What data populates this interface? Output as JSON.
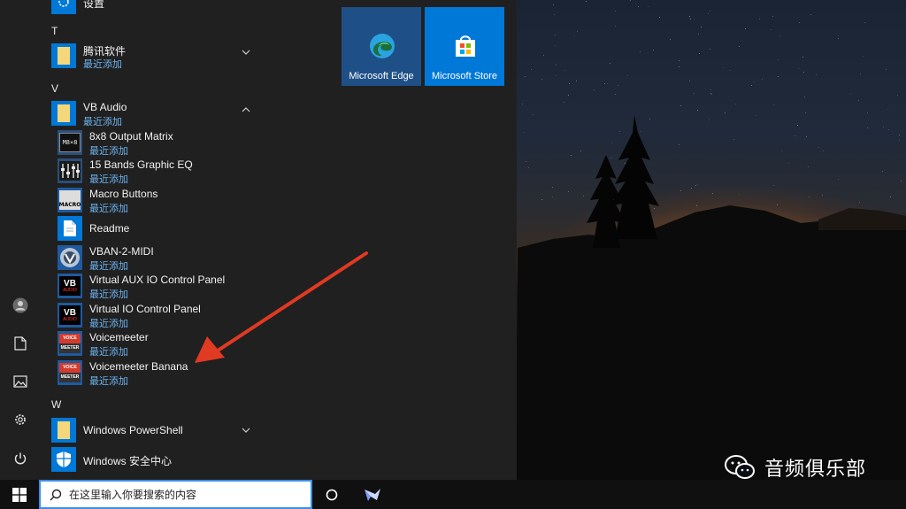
{
  "start_menu": {
    "partial_top_item": {
      "label": "设置"
    },
    "groups": [
      {
        "letter": "T",
        "items": [
          {
            "label": "腾讯软件",
            "sub": "最近添加",
            "icon": "folder-icon",
            "expandable": true
          }
        ]
      },
      {
        "letter": "V",
        "items": [
          {
            "label": "VB Audio",
            "sub": "最近添加",
            "icon": "folder-icon",
            "expanded": true
          }
        ]
      }
    ],
    "vb_audio_children": [
      {
        "label": "8x8 Output Matrix",
        "sub": "最近添加",
        "icon": "matrix-app-icon"
      },
      {
        "label": "15 Bands Graphic EQ",
        "sub": "最近添加",
        "icon": "equalizer-app-icon"
      },
      {
        "label": "Macro Buttons",
        "sub": "最近添加",
        "icon": "macro-app-icon"
      },
      {
        "label": "Readme",
        "sub": "",
        "icon": "document-icon"
      },
      {
        "label": "VBAN-2-MIDI",
        "sub": "最近添加",
        "icon": "vban-app-icon"
      },
      {
        "label": "Virtual AUX IO Control Panel",
        "sub": "最近添加",
        "icon": "vb-audio-icon"
      },
      {
        "label": "Virtual IO Control Panel",
        "sub": "最近添加",
        "icon": "vb-audio-icon"
      },
      {
        "label": "Voicemeeter",
        "sub": "最近添加",
        "icon": "voicemeeter-icon"
      },
      {
        "label": "Voicemeeter Banana",
        "sub": "最近添加",
        "icon": "voicemeeter-icon"
      }
    ],
    "group_w": {
      "letter": "W",
      "items": [
        {
          "label": "Windows PowerShell",
          "sub": "",
          "icon": "folder-icon",
          "expandable": true
        },
        {
          "label": "Windows 安全中心",
          "sub": "",
          "icon": "shield-icon"
        }
      ]
    },
    "tiles": [
      {
        "label": "Microsoft Edge",
        "icon": "edge-icon",
        "color": "#1f4f87"
      },
      {
        "label": "Microsoft Store",
        "icon": "store-icon",
        "color": "#0078d7"
      }
    ],
    "rail": {
      "icons": [
        "user-icon",
        "document-icon",
        "pictures-icon",
        "gear-icon",
        "power-icon"
      ]
    },
    "icon_glyphs": {
      "matrix_label": "M8×8",
      "macro_label": "MACRO",
      "vb_label": "VB",
      "vb_sub_label": "AUDIO",
      "voice_label_top": "VOICE",
      "voice_label_bottom": "MEETER"
    }
  },
  "taskbar": {
    "search_placeholder": "在这里输入你要搜索的内容"
  },
  "watermark": {
    "text": "音频俱乐部"
  },
  "colors": {
    "accent": "#0078d7",
    "recent_label": "#6db3f0",
    "folder": "#f4d77a",
    "annotation_arrow": "#e03a22"
  }
}
